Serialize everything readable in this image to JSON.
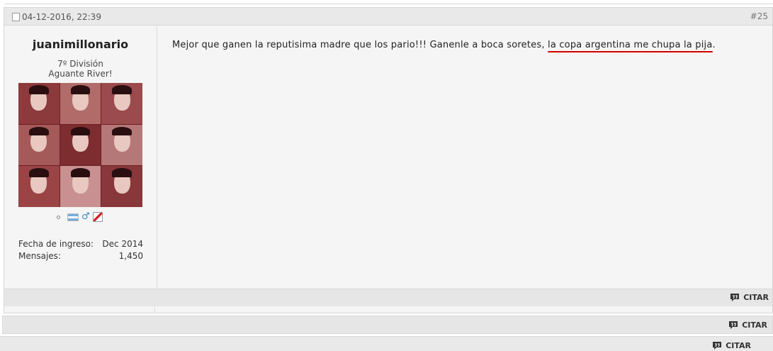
{
  "post": {
    "date": "04-12-2016, 22:39",
    "number": "#25",
    "user": {
      "name": "juanimillonario",
      "rank": "7º División",
      "custom_title": "Aguante River!",
      "join_label": "Fecha de ingreso:",
      "join_value": "Dec 2014",
      "posts_label": "Mensajes:",
      "posts_value": "1,450",
      "icons": [
        "online-status-icon",
        "argentina-flag-icon",
        "male-gender-icon",
        "club-badge-icon"
      ]
    },
    "message": {
      "text_before": "Mejor que ganen la reputisima madre que los pario!!! Ganenle a boca soretes, ",
      "text_highlight": "la copa argentina me chupa la pija",
      "text_after": ".",
      "highlight_color": "#d40000"
    },
    "quote_label": "CITAR"
  },
  "next_post": {
    "quote_label": "CITAR"
  },
  "third_post": {
    "quote_label": "CITAR"
  }
}
